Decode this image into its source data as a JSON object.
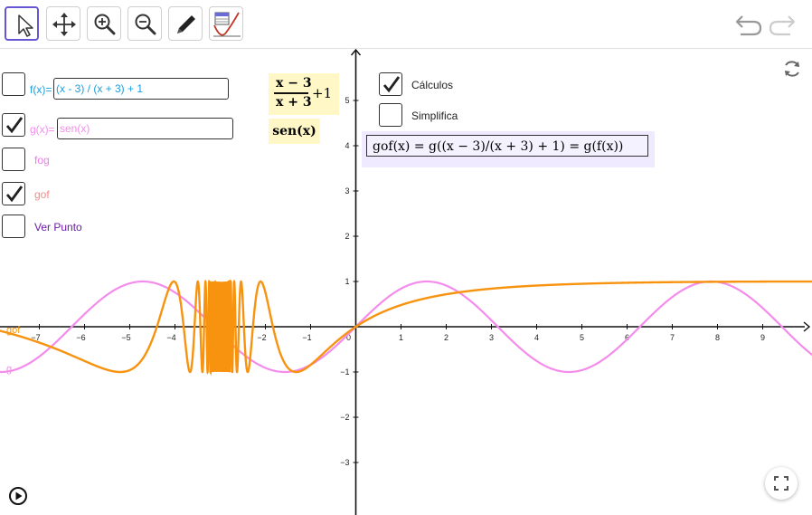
{
  "toolbar": {
    "tools": [
      {
        "name": "move-tool",
        "icon": "arrow-cursor-icon"
      },
      {
        "name": "move-graphics-view-tool",
        "icon": "four-arrows-icon"
      },
      {
        "name": "zoom-in-tool",
        "icon": "zoom-in-icon"
      },
      {
        "name": "zoom-out-tool",
        "icon": "zoom-out-icon"
      },
      {
        "name": "pen-tool",
        "icon": "pencil-icon"
      },
      {
        "name": "function-inspector-tool",
        "icon": "function-inspector-icon"
      }
    ],
    "undo_icon": "undo-icon",
    "redo_icon": "redo-icon"
  },
  "controls": {
    "f_label": "f(x)=",
    "f_value": "(x - 3) / (x + 3) + 1",
    "g_label": "g(x)=",
    "g_value": "sen(x)",
    "fog_label": "fog",
    "gof_label": "gof",
    "verpunto_label": "Ver Punto",
    "calculos_label": "Cálculos",
    "simplifica_label": "Simplifica",
    "fog_checked": false,
    "gof_checked": true,
    "f_checked": false,
    "g_checked": true,
    "verpunto_checked": false,
    "calculos_checked": true,
    "simplifica_checked": false
  },
  "latex": {
    "f_numerator": "x − 3",
    "f_denominator": "x + 3",
    "f_plus": "+1",
    "g_text": "sen(x)"
  },
  "calc": {
    "expression": "gof(x) =   g((x − 3)/(x + 3) + 1)   =   g(f(x))"
  },
  "curve_labels": {
    "gof": "gof",
    "g": "g"
  },
  "colors": {
    "f": "#1a9ee0",
    "g": "#f48cec",
    "gof": "#f7930f",
    "fog": "#e97ee9",
    "verpunto": "#6a1aa5",
    "accent": "#6557d2"
  },
  "axes": {
    "x_ticks": [
      "−7",
      "−6",
      "−5",
      "−4",
      "−3",
      "−2",
      "−1",
      "0",
      "1",
      "2",
      "3",
      "4",
      "5",
      "6",
      "7",
      "8",
      "9"
    ],
    "y_ticks": [
      "5",
      "4",
      "3",
      "2",
      "1",
      "−1",
      "−2",
      "−3"
    ]
  },
  "corner_icons": {
    "reset": "refresh-icon",
    "fullscreen": "fullscreen-icon",
    "play": "play-icon"
  }
}
